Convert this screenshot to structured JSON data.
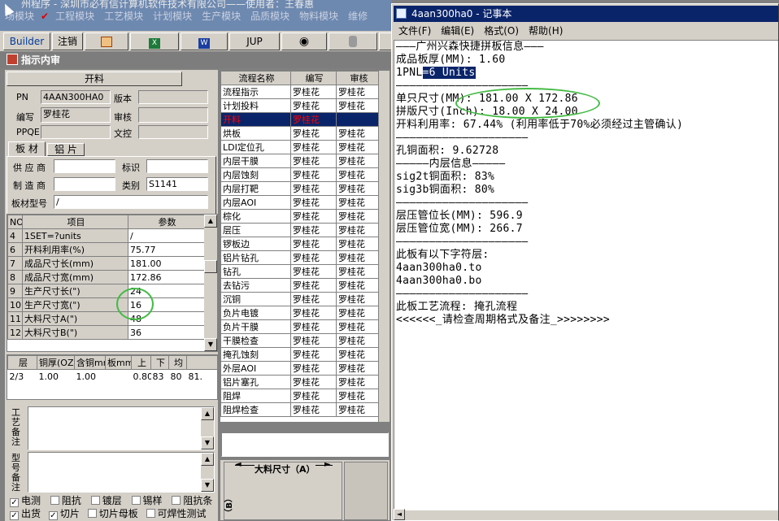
{
  "app": {
    "title": "州程序 - 深圳市必有信计算机软件技术有限公司——使用者：王春惠",
    "menu": [
      "场模块",
      "工艺模块",
      "工程模块",
      "计划模块",
      "生产模块",
      "品质模块",
      "物料模块",
      "维修"
    ],
    "toolbar": [
      "Builder",
      "注销",
      "JUP"
    ]
  },
  "inner": {
    "title": "指示内审",
    "kailiao": "开料",
    "pn_label": "PN",
    "pn_value": "4AAN300HA0",
    "banben_label": "版本",
    "banben_value": "",
    "bianhao_label": "编写",
    "bianhao_value": "罗桂花",
    "shenhe_label": "审核",
    "shenhe_value": "",
    "ppqe_label": "PPQE",
    "ppqe_value": "",
    "wenkong_label": "文控",
    "wenkong_value": "",
    "tabs": [
      "板 材",
      "铝 片"
    ],
    "supplier_label": "供 应 商",
    "supplier_value": "",
    "biaoshi_label": "标识",
    "biaoshi_value": "",
    "maker_label": "制 造 商",
    "maker_value": "",
    "leibie_label": "类别",
    "leibie_value": "S1141",
    "model_label": "板材型号",
    "model_value": "/"
  },
  "params": {
    "headers": [
      "NO",
      "项目",
      "参数"
    ],
    "rows": [
      {
        "no": "4",
        "item": "1SET=?units",
        "val": "/"
      },
      {
        "no": "6",
        "item": "开料利用率(%)",
        "val": "75.77"
      },
      {
        "no": "7",
        "item": "成品尺寸长(mm)",
        "val": "181.00"
      },
      {
        "no": "8",
        "item": "成品尺寸宽(mm)",
        "val": "172.86"
      },
      {
        "no": "9",
        "item": "生产尺寸长(\")",
        "val": "24"
      },
      {
        "no": "10",
        "item": "生产尺寸宽(\")",
        "val": "16"
      },
      {
        "no": "11",
        "item": "大料尺寸A(\")",
        "val": "48"
      },
      {
        "no": "12",
        "item": "大料尺寸B(\")",
        "val": "36"
      }
    ]
  },
  "layers": {
    "headers": [
      "层",
      "铜厚(OZ)",
      "含铜mm",
      "板mm",
      "上",
      "下",
      "均"
    ],
    "row": [
      "2/3",
      "1.00",
      "1.00",
      "",
      "0.80",
      "83",
      "80",
      "81."
    ]
  },
  "notes": {
    "gongyi": "工艺备注",
    "xinghao": "型号备注"
  },
  "checks": [
    [
      {
        "label": "电测",
        "on": true
      },
      {
        "label": "阻抗",
        "on": false
      },
      {
        "label": "镀层",
        "on": false
      },
      {
        "label": "锡样",
        "on": false
      },
      {
        "label": "阻抗条",
        "on": false
      }
    ],
    [
      {
        "label": "出货",
        "on": true
      },
      {
        "label": "切片",
        "on": true
      },
      {
        "label": "切片母板",
        "on": false
      },
      {
        "label": "可焊性测试",
        "on": false
      }
    ]
  ],
  "flow": {
    "headers": [
      "流程名称",
      "编写",
      "审核"
    ],
    "rows": [
      [
        "流程指示",
        "罗桂花",
        "罗桂花"
      ],
      [
        "计划投料",
        "罗桂花",
        "罗桂花"
      ],
      [
        "开料",
        "罗桂花",
        ""
      ],
      [
        "烘板",
        "罗桂花",
        "罗桂花"
      ],
      [
        "LDI定位孔",
        "罗桂花",
        "罗桂花"
      ],
      [
        "内层干膜",
        "罗桂花",
        "罗桂花"
      ],
      [
        "内层蚀刻",
        "罗桂花",
        "罗桂花"
      ],
      [
        "内层打靶",
        "罗桂花",
        "罗桂花"
      ],
      [
        "内层AOI",
        "罗桂花",
        "罗桂花"
      ],
      [
        "棕化",
        "罗桂花",
        "罗桂花"
      ],
      [
        "层压",
        "罗桂花",
        "罗桂花"
      ],
      [
        "锣板边",
        "罗桂花",
        "罗桂花"
      ],
      [
        "铝片钻孔",
        "罗桂花",
        "罗桂花"
      ],
      [
        "钻孔",
        "罗桂花",
        "罗桂花"
      ],
      [
        "去钻污",
        "罗桂花",
        "罗桂花"
      ],
      [
        "沉铜",
        "罗桂花",
        "罗桂花"
      ],
      [
        "负片电镀",
        "罗桂花",
        "罗桂花"
      ],
      [
        "负片干膜",
        "罗桂花",
        "罗桂花"
      ],
      [
        "干膜检查",
        "罗桂花",
        "罗桂花"
      ],
      [
        "掩孔蚀刻",
        "罗桂花",
        "罗桂花"
      ],
      [
        "外层AOI",
        "罗桂花",
        "罗桂花"
      ],
      [
        "铝片塞孔",
        "罗桂花",
        "罗桂花"
      ],
      [
        "阻焊",
        "罗桂花",
        "罗桂花"
      ],
      [
        "阻焊检查",
        "罗桂花",
        "罗桂花"
      ]
    ],
    "selected": 2
  },
  "sketch": {
    "a_label": "大料尺寸（A）",
    "b_label": "（B）"
  },
  "notepad": {
    "title": "4aan300ha0 - 记事本",
    "menu": [
      "文件(F)",
      "编辑(E)",
      "格式(O)",
      "帮助(H)"
    ],
    "lines": [
      "———广州兴森快捷拼板信息———",
      "成品板厚(MM): 1.60",
      "1PNL=6 Units",
      "————————————————————",
      "单只尺寸(MM): 181.00 X 172.86",
      "拼版尺寸(Inch): 18.00 X 24.00",
      "开料利用率: 67.44% (利用率低于70%必须经过主管确认)",
      "————————————————————",
      "孔铜面积: 9.62728",
      "—————内层信息—————",
      "sig2t铜面积: 83%",
      "sig3b铜面积: 80%",
      "————————————————————",
      "层压管位长(MM): 596.9",
      "层压管位宽(MM): 266.7",
      "————————————————————",
      "此板有以下字符层:",
      "4aan300ha0.to",
      "4aan300ha0.bo",
      "————————————————————",
      "此板工艺流程: 掩孔流程",
      "<<<<<<_请检查周期格式及备注_>>>>>>>>"
    ]
  },
  "colors": {
    "selection": "#0a246a",
    "selected_row": "#0a246a",
    "selected_text": "#ff0000",
    "highlight_circle": "#44bb44"
  }
}
